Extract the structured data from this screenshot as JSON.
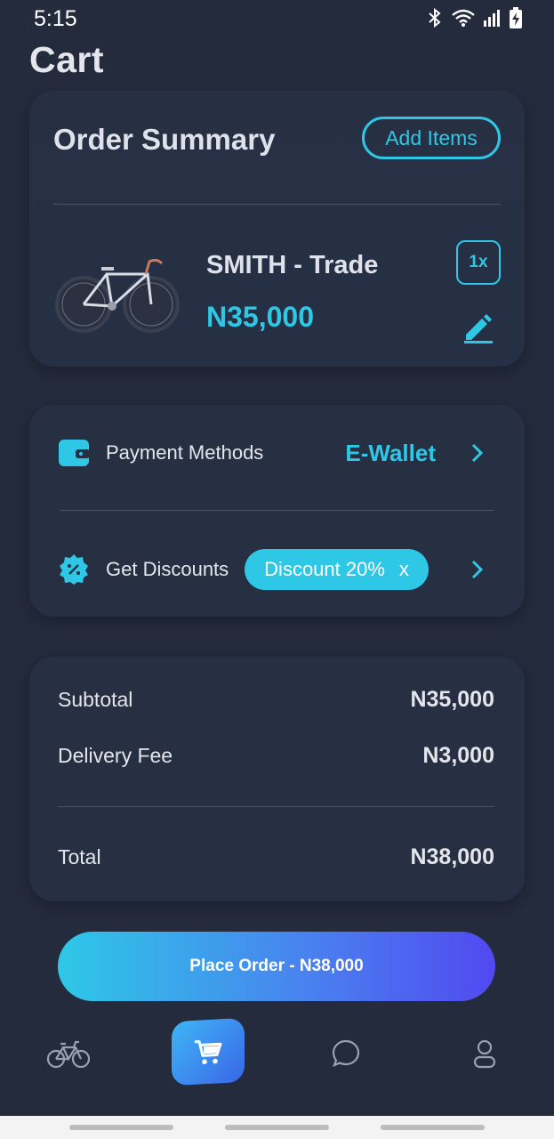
{
  "status_bar": {
    "time": "5:15"
  },
  "page": {
    "title": "Cart"
  },
  "order_summary": {
    "title": "Order Summary",
    "add_items_label": "Add Items",
    "item": {
      "name": "SMITH - Trade",
      "price": "N35,000",
      "quantity": "1x"
    }
  },
  "payment": {
    "methods_label": "Payment Methods",
    "method_value": "E-Wallet",
    "discounts_label": "Get Discounts",
    "discount_tag": "Discount 20%",
    "discount_remove": "x"
  },
  "totals": {
    "subtotal_label": "Subtotal",
    "subtotal_value": "N35,000",
    "delivery_label": "Delivery Fee",
    "delivery_value": "N3,000",
    "total_label": "Total",
    "total_value": "N38,000"
  },
  "place_order_label": "Place Order - N38,000",
  "bottom_nav": {
    "items": [
      {
        "icon": "bicycle-icon",
        "active": false
      },
      {
        "icon": "cart-icon",
        "active": true
      },
      {
        "icon": "chat-icon",
        "active": false
      },
      {
        "icon": "profile-icon",
        "active": false
      }
    ]
  },
  "colors": {
    "accent": "#2ec8e6",
    "background": "#242b3d",
    "card": "#273043",
    "gradient_end": "#5149f0"
  }
}
